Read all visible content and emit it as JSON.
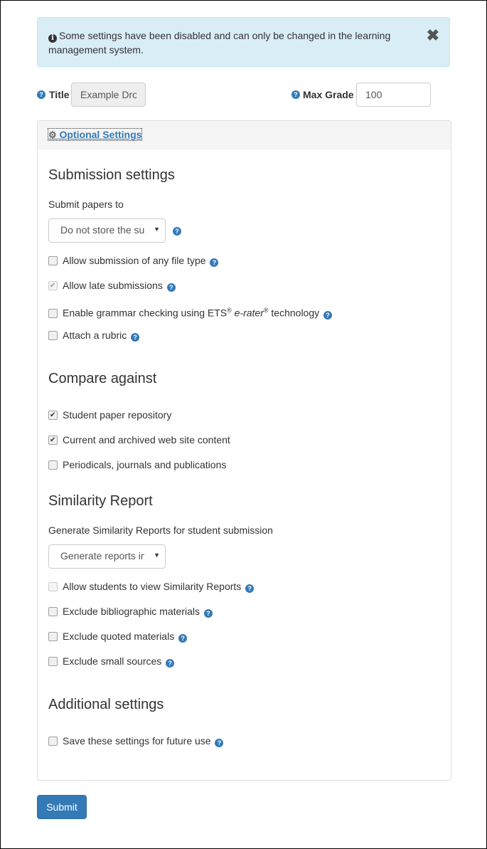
{
  "alert": {
    "text": "Some settings have been disabled and can only be changed in the learning management system.",
    "close_label": "✖"
  },
  "title_field": {
    "label": "Title",
    "value": "Example Dropbox"
  },
  "max_grade_field": {
    "label": "Max Grade",
    "value": "100"
  },
  "optional_settings": {
    "label": "Optional Settings"
  },
  "submission": {
    "heading": "Submission settings",
    "submit_to_label": "Submit papers to",
    "submit_to_value": "Do not store the submitted papers",
    "options": [
      {
        "label": "Allow submission of any file type",
        "checked": false,
        "disabled": false,
        "help": true
      },
      {
        "label": "Allow late submissions",
        "checked": true,
        "disabled": true,
        "help": true
      },
      {
        "label_pre": "Enable grammar checking using ETS",
        "label_mid": "e-rater",
        "label_post": " technology",
        "checked": false,
        "disabled": false,
        "help": true
      },
      {
        "label": "Attach a rubric",
        "checked": false,
        "disabled": false,
        "help": true
      }
    ]
  },
  "compare": {
    "heading": "Compare against",
    "options": [
      {
        "label": "Student paper repository",
        "checked": true
      },
      {
        "label": "Current and archived web site content",
        "checked": true
      },
      {
        "label": "Periodicals, journals and publications",
        "checked": false
      }
    ]
  },
  "similarity": {
    "heading": "Similarity Report",
    "generate_label": "Generate Similarity Reports for student submission",
    "generate_value": "Generate reports immediately",
    "options": [
      {
        "label": "Allow students to view Similarity Reports",
        "checked": false,
        "disabled": true
      },
      {
        "label": "Exclude bibliographic materials",
        "checked": false
      },
      {
        "label": "Exclude quoted materials",
        "checked": false
      },
      {
        "label": "Exclude small sources",
        "checked": false
      }
    ]
  },
  "additional": {
    "heading": "Additional settings",
    "options": [
      {
        "label": "Save these settings for future use",
        "checked": false
      }
    ]
  },
  "submit_label": "Submit"
}
